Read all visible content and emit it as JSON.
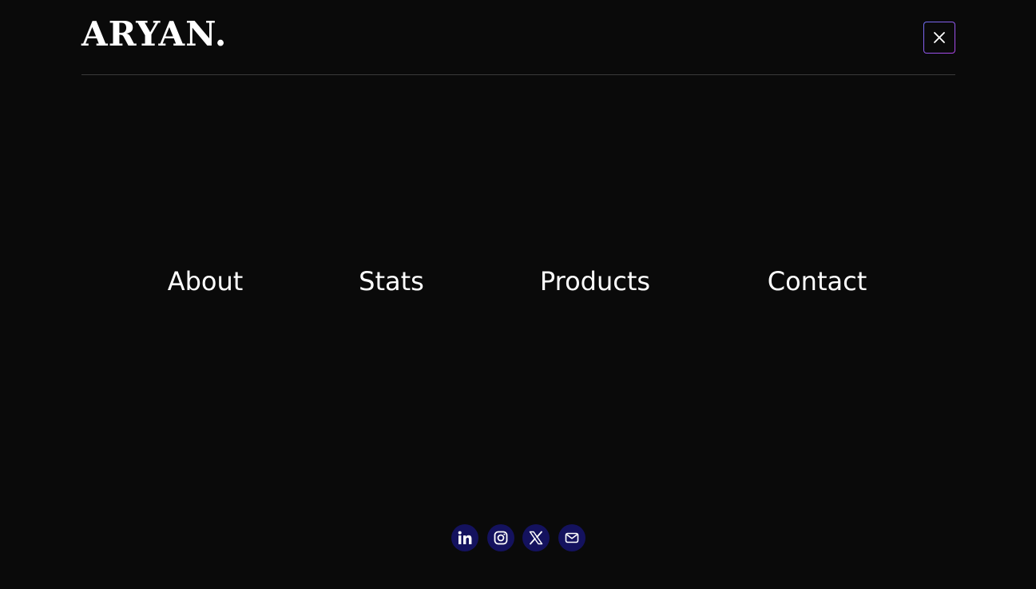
{
  "header": {
    "logo_text": "ARYAN.",
    "close_icon": "close-icon",
    "close_border_colors": [
      "#6d6ef0",
      "#b044e8"
    ]
  },
  "nav": {
    "items": [
      {
        "label": "About"
      },
      {
        "label": "Stats"
      },
      {
        "label": "Products"
      },
      {
        "label": "Contact"
      }
    ]
  },
  "socials": {
    "icons": [
      "linkedin-icon",
      "instagram-icon",
      "x-icon",
      "mail-icon"
    ],
    "button_color": "#14125e"
  },
  "colors": {
    "background": "#0a0a0a",
    "text": "#ffffff",
    "divider": "#3a3a3a"
  }
}
